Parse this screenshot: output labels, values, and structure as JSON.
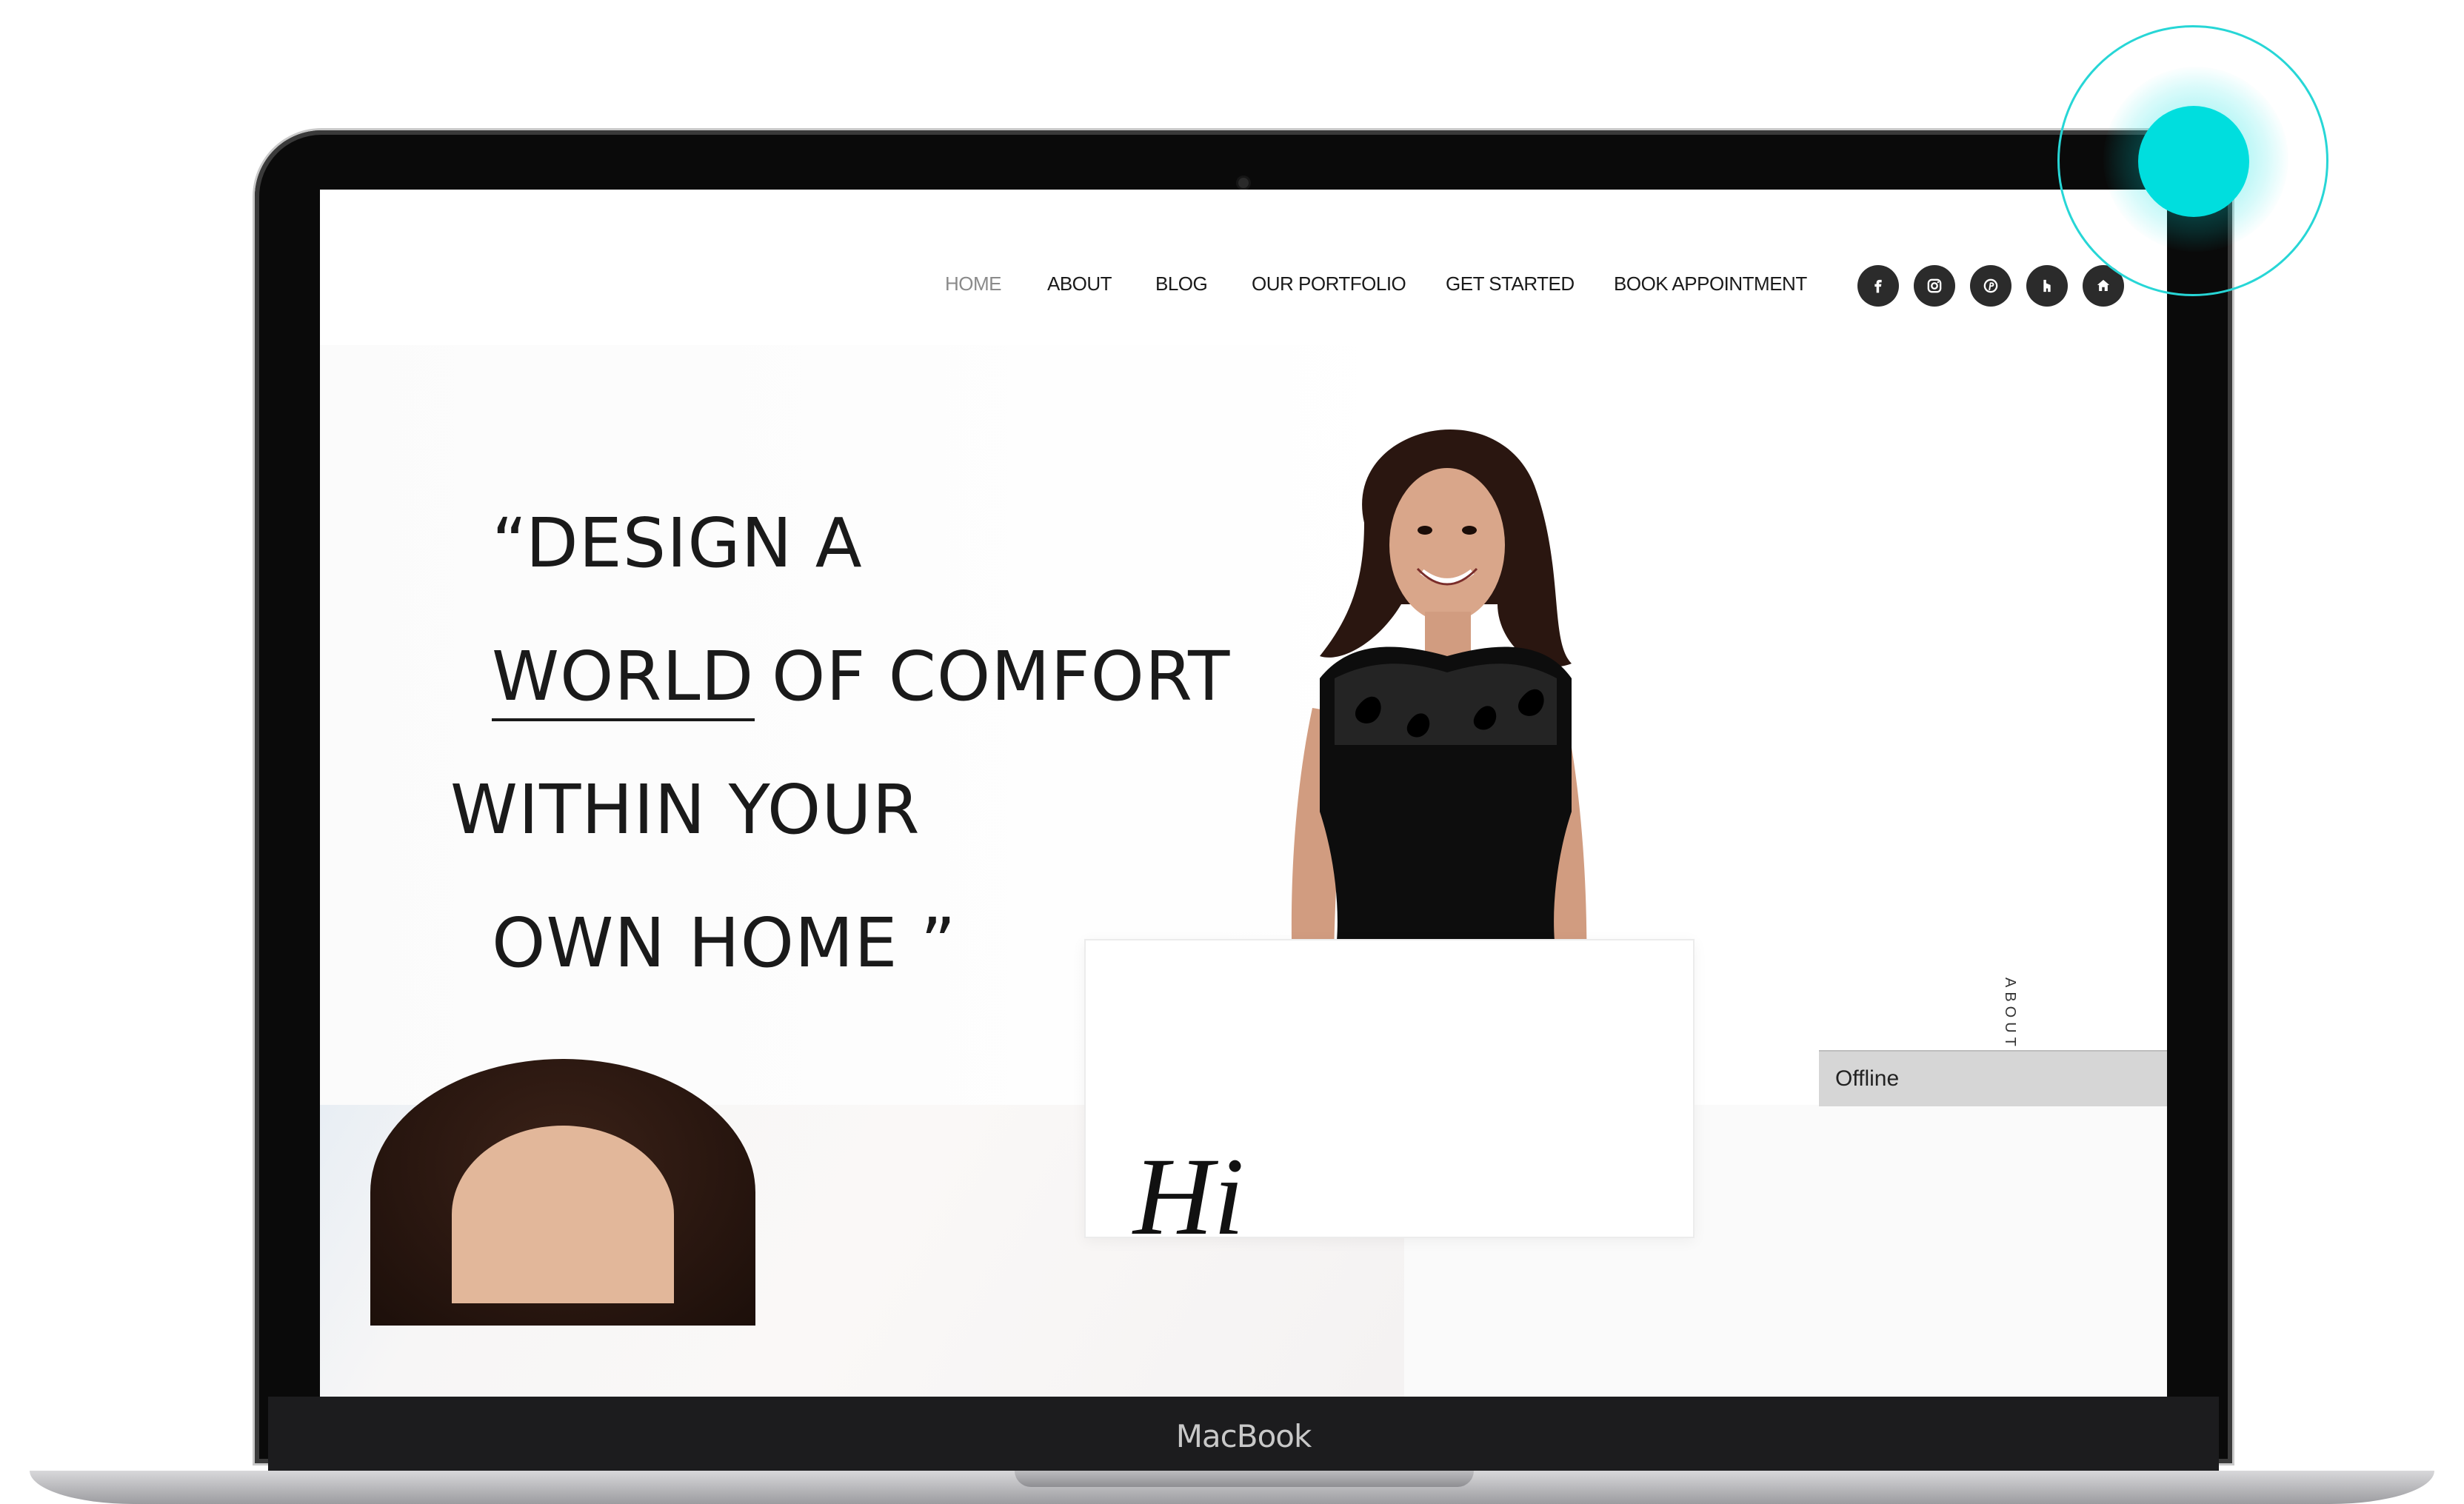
{
  "device": {
    "label": "MacBook"
  },
  "nav": {
    "items": [
      {
        "label": "HOME",
        "active": true
      },
      {
        "label": "ABOUT",
        "active": false
      },
      {
        "label": "BLOG",
        "active": false
      },
      {
        "label": "OUR PORTFOLIO",
        "active": false
      },
      {
        "label": "GET STARTED",
        "active": false
      },
      {
        "label": "BOOK APPOINTMENT",
        "active": false
      }
    ],
    "social_icons": [
      "facebook-icon",
      "instagram-icon",
      "pinterest-icon",
      "houzz-icon",
      "home-icon"
    ]
  },
  "hero": {
    "quote_lines": [
      "“DESIGN A",
      "WORLD",
      "OF COMFORT",
      "WITHIN YOUR",
      "OWN HOME ”"
    ]
  },
  "chat": {
    "status": "Offline"
  },
  "about": {
    "section_label": "ABOUT",
    "greeting": "Hi"
  },
  "colors": {
    "touch_indicator": "#00dede",
    "nav_text": "#1a1a1a",
    "nav_active": "#8a8a8a",
    "social_bg": "#2b2b2b"
  }
}
